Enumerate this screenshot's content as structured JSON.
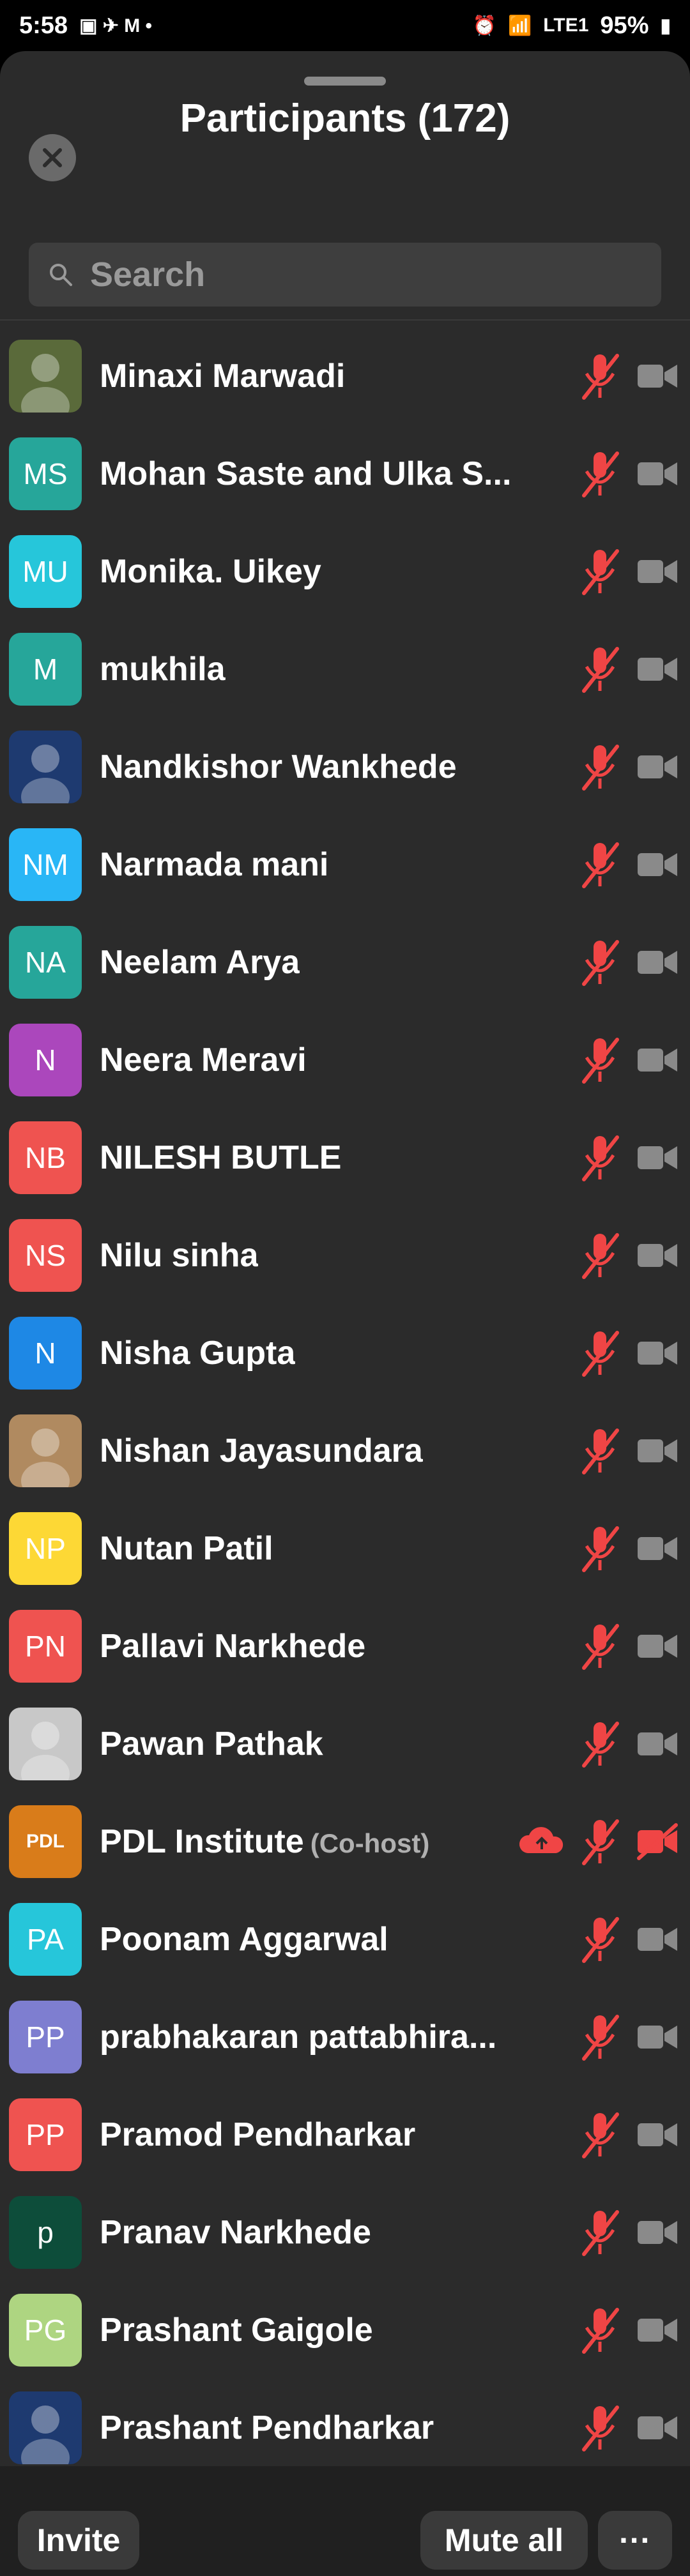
{
  "status": {
    "time": "5:58",
    "battery": "95%",
    "network": "LTE1"
  },
  "header": {
    "title": "Participants (172)"
  },
  "search": {
    "placeholder": "Search"
  },
  "participants": [
    {
      "name": "Minaxi Marwadi",
      "initials": "",
      "color": "#5a6a3a"
    },
    {
      "name": "Mohan Saste and Ulka S...",
      "initials": "MS",
      "color": "#26a69a"
    },
    {
      "name": "Monika. Uikey",
      "initials": "MU",
      "color": "#26c6da"
    },
    {
      "name": "mukhila",
      "initials": "M",
      "color": "#26a69a"
    },
    {
      "name": "Nandkishor Wankhede",
      "initials": "",
      "color": "#1e3a70"
    },
    {
      "name": "Narmada mani",
      "initials": "NM",
      "color": "#29b6f6"
    },
    {
      "name": "Neelam Arya",
      "initials": "NA",
      "color": "#26a69a"
    },
    {
      "name": "Neera Meravi",
      "initials": "N",
      "color": "#ab47bc"
    },
    {
      "name": "NILESH BUTLE",
      "initials": "NB",
      "color": "#ef5350"
    },
    {
      "name": "Nilu sinha",
      "initials": "NS",
      "color": "#ef5350"
    },
    {
      "name": "Nisha Gupta",
      "initials": "N",
      "color": "#1e88e5"
    },
    {
      "name": "Nishan Jayasundara",
      "initials": "",
      "color": "#b08a60"
    },
    {
      "name": "Nutan Patil",
      "initials": "NP",
      "color": "#fdd835"
    },
    {
      "name": "Pallavi Narkhede",
      "initials": "PN",
      "color": "#ef5350"
    },
    {
      "name": "Pawan Pathak",
      "initials": "",
      "color": "#c8c8c8"
    },
    {
      "name": "PDL Institute",
      "initials": "PDL",
      "color": "#d97c1a",
      "cohost": "(Co-host)"
    },
    {
      "name": "Poonam Aggarwal",
      "initials": "PA",
      "color": "#26c6da"
    },
    {
      "name": "prabhakaran pattabhira...",
      "initials": "PP",
      "color": "#7e7ed0"
    },
    {
      "name": "Pramod Pendharkar",
      "initials": "PP",
      "color": "#ef5350"
    },
    {
      "name": "Pranav Narkhede",
      "initials": "p",
      "color": "#0d4d3a"
    },
    {
      "name": "Prashant Gaigole",
      "initials": "PG",
      "color": "#aed581"
    },
    {
      "name": "Prashant Pendharkar",
      "initials": "",
      "color": "#1e3a70"
    }
  ],
  "footer": {
    "invite": "Invite",
    "mute_all": "Mute all",
    "more": "···"
  },
  "colors": {
    "muted_red": "#f04545",
    "cam_gray": "#8a8a8a",
    "sheet_bg": "#2b2b2b"
  }
}
